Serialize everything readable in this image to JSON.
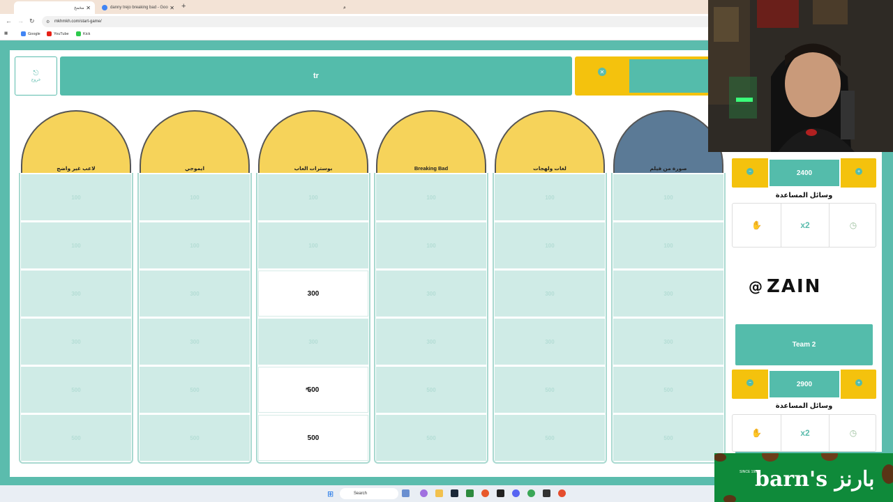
{
  "browser": {
    "tabs": [
      {
        "label": "مخمخ",
        "active": true
      },
      {
        "label": "danny trejo breaking bad - Goo",
        "active": false
      }
    ],
    "url": "mkhmkh.com/start-game/",
    "bookmarks": [
      "Google",
      "YouTube",
      "Kick"
    ]
  },
  "game": {
    "exit_label": "خروج",
    "title": "tr",
    "categories": [
      {
        "label": "لاعب غير واضح",
        "color": "#f6d35a"
      },
      {
        "label": "ايموجي",
        "color": "#f6d35a"
      },
      {
        "label": "بوسترات العاب",
        "color": "#f6d35a"
      },
      {
        "label": "Breaking Bad",
        "color": "#f6d35a"
      },
      {
        "label": "لغات ولهجات",
        "color": "#f6d35a"
      },
      {
        "label": "صورة من فيلم",
        "color": "#5b7a96"
      }
    ],
    "rows": [
      [
        "100",
        "100",
        "100",
        "100",
        "100",
        "100"
      ],
      [
        "100",
        "100",
        "100",
        "100",
        "100",
        "100"
      ],
      [
        "300",
        "300",
        "300",
        "300",
        "300",
        "300"
      ],
      [
        "300",
        "300",
        "300",
        "300",
        "300",
        "300"
      ],
      [
        "500",
        "500",
        "500",
        "500",
        "500",
        "500"
      ],
      [
        "500",
        "500",
        "500",
        "500",
        "500",
        "500"
      ]
    ],
    "open_cells": [
      [
        2,
        2
      ],
      [
        4,
        2
      ],
      [
        5,
        2
      ]
    ]
  },
  "sidebar": {
    "team1": {
      "score": "2400",
      "help_title": "وسائل المساعدة"
    },
    "sponsor": "ZAIN",
    "team2": {
      "name": "Team 2",
      "score": "2900",
      "help_title": "وسائل المساعدة"
    },
    "help_items": [
      "hand-icon",
      "x2",
      "timer-icon"
    ],
    "double_label": "x2"
  },
  "overlay": {
    "sponsor_brand": "barn's",
    "sponsor_arabic": "بارنز",
    "sponsor_since": "SINCE 1992"
  },
  "taskbar": {
    "search_placeholder": "Search"
  },
  "colors": {
    "teal": "#54bcab",
    "yellow": "#f4c20d",
    "cell": "#cfebe6"
  }
}
